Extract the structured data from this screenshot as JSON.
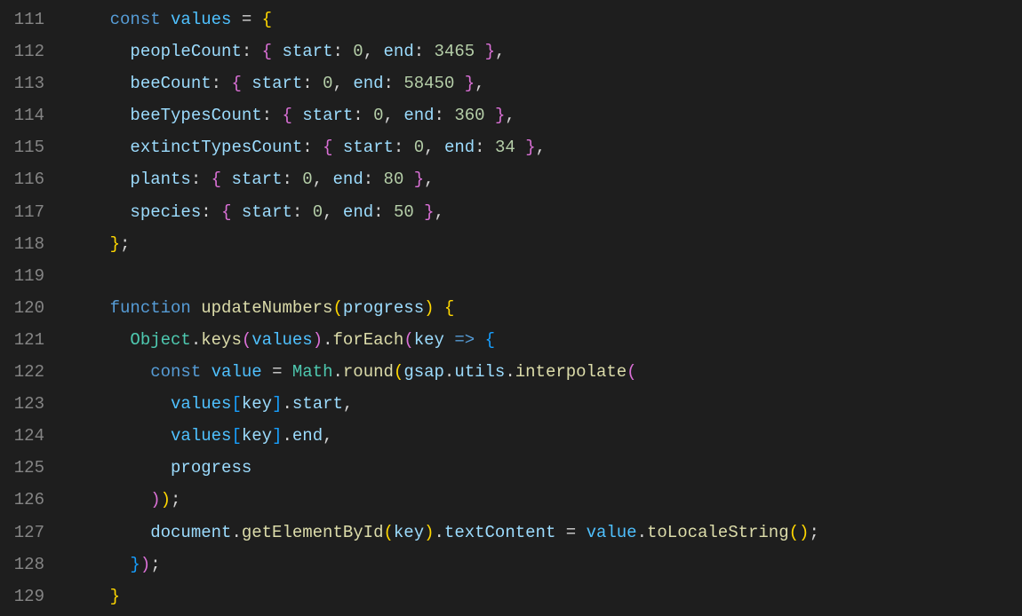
{
  "lines": [
    {
      "num": "111"
    },
    {
      "num": "112"
    },
    {
      "num": "113"
    },
    {
      "num": "114"
    },
    {
      "num": "115"
    },
    {
      "num": "116"
    },
    {
      "num": "117"
    },
    {
      "num": "118"
    },
    {
      "num": "119"
    },
    {
      "num": "120"
    },
    {
      "num": "121"
    },
    {
      "num": "122"
    },
    {
      "num": "123"
    },
    {
      "num": "124"
    },
    {
      "num": "125"
    },
    {
      "num": "126"
    },
    {
      "num": "127"
    },
    {
      "num": "128"
    },
    {
      "num": "129"
    }
  ],
  "tokens": {
    "const": "const",
    "function": "function",
    "values": "values",
    "peopleCount": "peopleCount",
    "beeCount": "beeCount",
    "beeTypesCount": "beeTypesCount",
    "extinctTypesCount": "extinctTypesCount",
    "plants": "plants",
    "species": "species",
    "start": "start",
    "end": "end",
    "updateNumbers": "updateNumbers",
    "progress": "progress",
    "Object": "Object",
    "keys": "keys",
    "forEach": "forEach",
    "key": "key",
    "arrow": "=>",
    "value": "value",
    "Math": "Math",
    "round": "round",
    "gsap": "gsap",
    "utils": "utils",
    "interpolate": "interpolate",
    "document": "document",
    "getElementById": "getElementById",
    "textContent": "textContent",
    "toLocaleString": "toLocaleString",
    "n0": "0",
    "n3465": "3465",
    "n58450": "58450",
    "n360": "360",
    "n34": "34",
    "n80": "80",
    "n50": "50"
  }
}
